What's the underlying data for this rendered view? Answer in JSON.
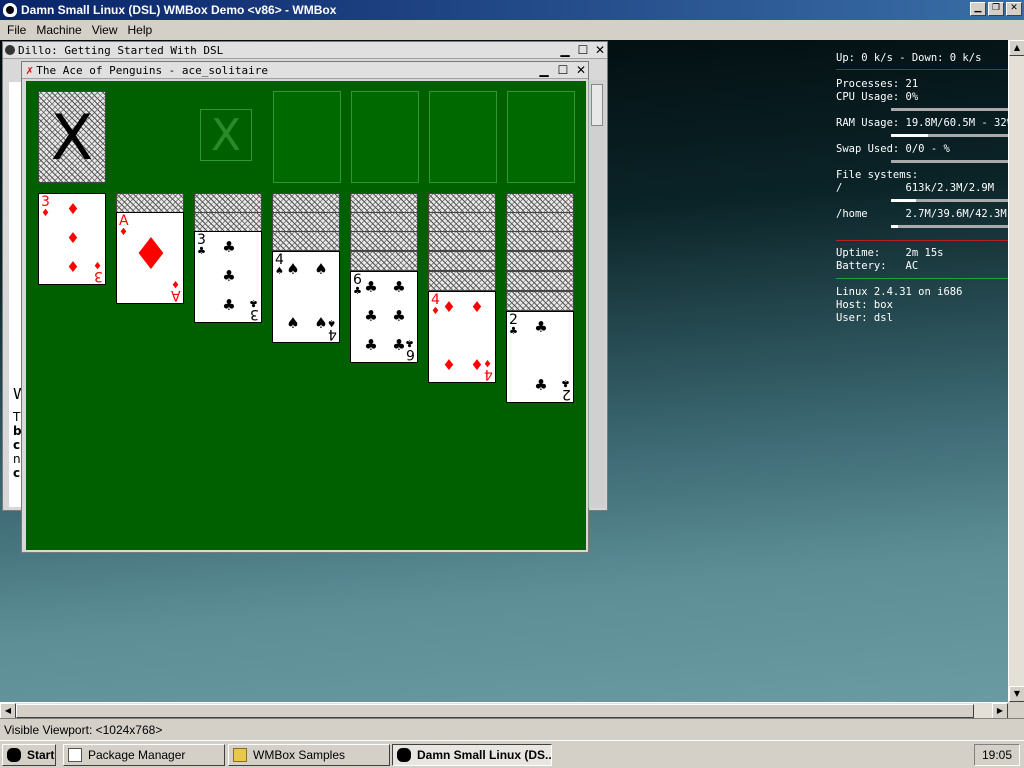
{
  "host": {
    "title": "Damn Small Linux (DSL) WMBox Demo <v86> - WMBox",
    "menu": [
      "File",
      "Machine",
      "View",
      "Help"
    ]
  },
  "dillo": {
    "title": "Dillo: Getting Started With DSL",
    "fragments": [
      "W",
      "Th",
      "bu",
      "cli",
      "no",
      "cli"
    ]
  },
  "solitaire": {
    "title": "The Ace of Penguins - ace_solitaire",
    "stock_glyph": "X",
    "waste_glyph": "X",
    "tableau": [
      {
        "rank": "3",
        "suit": "♦",
        "color": "red"
      },
      {
        "rank": "A",
        "suit": "♦",
        "color": "red"
      },
      {
        "rank": "3",
        "suit": "♣",
        "color": "black"
      },
      {
        "rank": "4",
        "suit": "♠",
        "color": "black"
      },
      {
        "rank": "6",
        "suit": "♣",
        "color": "black"
      },
      {
        "rank": "4",
        "suit": "♦",
        "color": "red"
      },
      {
        "rank": "2",
        "suit": "♣",
        "color": "black"
      }
    ]
  },
  "conky": {
    "net": "Up: 0 k/s - Down: 0 k/s",
    "processes": "Processes: 21",
    "cpu": "CPU Usage: 0%",
    "ram": "RAM Usage: 19.8M/60.5M - 32%",
    "swap": "Swap Used: 0/0 - %",
    "fs_header": "File systems:",
    "fs_root": "/          613k/2.3M/2.9M",
    "fs_home": "/home      2.7M/39.6M/42.3M",
    "uptime": "Uptime:    2m 15s",
    "battery": "Battery:   AC",
    "kernel": "Linux 2.4.31 on i686",
    "host": "Host: box",
    "user": "User: dsl"
  },
  "status": "Visible Viewport: <1024x768>",
  "taskbar": {
    "start": "Start",
    "items": [
      "Package Manager",
      "WMBox Samples",
      "Damn Small Linux (DS..."
    ],
    "clock": "19:05"
  }
}
